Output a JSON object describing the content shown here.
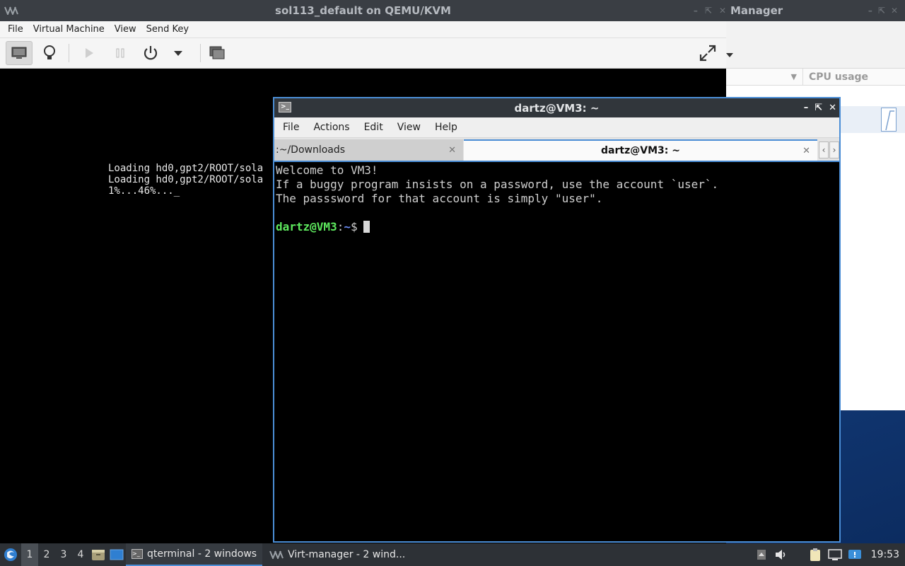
{
  "manager": {
    "title": "Manager",
    "cpu_column": "CPU usage"
  },
  "viewer": {
    "title": "sol113_default on QEMU/KVM",
    "menu": [
      "File",
      "Virtual Machine",
      "View",
      "Send Key"
    ],
    "boot_lines": [
      "Loading hd0,gpt2/ROOT/sola",
      "Loading hd0,gpt2/ROOT/sola",
      "1%...46%..._"
    ]
  },
  "terminal": {
    "title": "dartz@VM3: ~",
    "menu": [
      "File",
      "Actions",
      "Edit",
      "View",
      "Help"
    ],
    "tabs": [
      {
        "label": ":~/Downloads",
        "active": false
      },
      {
        "label": "dartz@VM3: ~",
        "active": true
      }
    ],
    "lines": [
      "Welcome to VM3!",
      "If a buggy program insists on a password, use the account `user`.",
      "The passsword for that account is simply \"user\"."
    ],
    "prompt_user": "dartz@VM3",
    "prompt_sep": ":",
    "prompt_path": "~",
    "prompt_char": "$"
  },
  "taskbar": {
    "workspaces": [
      "1",
      "2",
      "3",
      "4"
    ],
    "active_workspace": "1",
    "tasks": [
      {
        "label": "qterminal - 2 windows",
        "icon": "terminal-icon",
        "active": true
      },
      {
        "label": "Virt-manager - 2 wind...",
        "icon": "virt-manager-icon",
        "active": false
      }
    ],
    "clock": "19:53"
  },
  "colors": {
    "accent": "#4b8ed6",
    "prompt_user": "#5de85d",
    "prompt_path": "#6a8cf5",
    "titlebar": "#3a3e44"
  }
}
